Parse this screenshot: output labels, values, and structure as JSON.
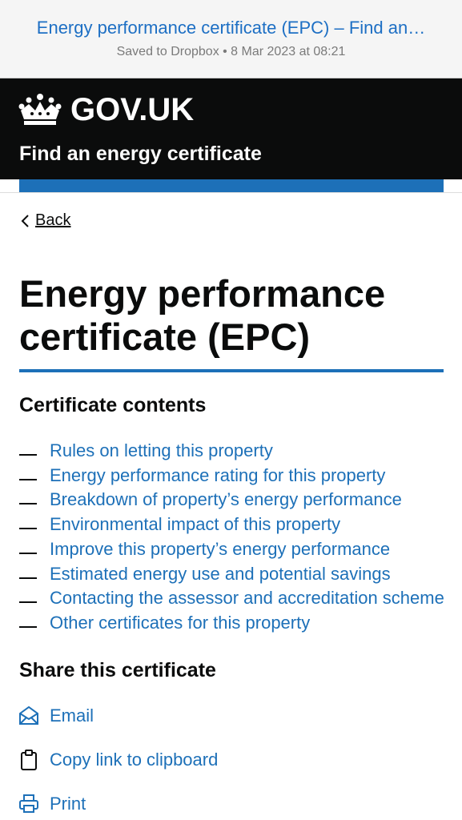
{
  "browser_bar": {
    "title": "Energy performance certificate (EPC) – Find an…",
    "subtitle": "Saved to Dropbox • 8 Mar 2023 at 08:21"
  },
  "header": {
    "wordmark": "GOV.UK",
    "service_name": "Find an energy certificate"
  },
  "back_link": "Back",
  "page_title": "Energy performance certificate (EPC)",
  "contents": {
    "heading": "Certificate contents",
    "items": [
      "Rules on letting this property",
      "Energy performance rating for this property",
      "Breakdown of property’s energy performance",
      "Environmental impact of this property",
      "Improve this property’s energy performance",
      "Estimated energy use and potential savings",
      "Contacting the assessor and accreditation scheme",
      "Other certificates for this property"
    ]
  },
  "share": {
    "heading": "Share this certificate",
    "email_label": "Email",
    "copy_label": "Copy link to clipboard",
    "print_label": "Print"
  },
  "colors": {
    "link": "#1d70b8",
    "header_bg": "#0b0c0c",
    "accent": "#1d70b8"
  }
}
